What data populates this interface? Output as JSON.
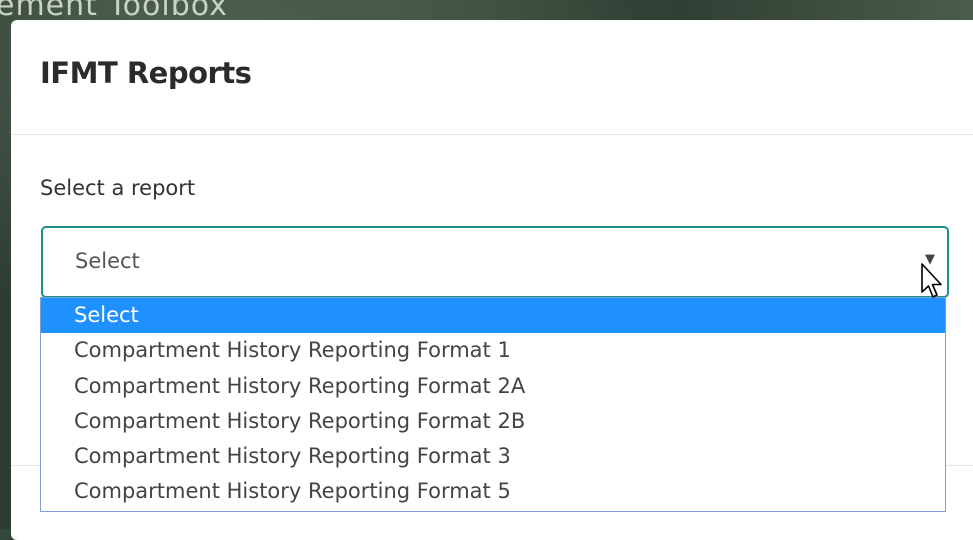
{
  "background": {
    "text": "ement Toolbox"
  },
  "modal": {
    "title": "IFMT Reports",
    "field_label": "Select a report",
    "select": {
      "value": "Select",
      "arrow_icon": "caret-down-icon",
      "options": [
        {
          "label": "Select",
          "selected": true
        },
        {
          "label": "Compartment History Reporting Format 1",
          "selected": false
        },
        {
          "label": "Compartment History Reporting Format 2A",
          "selected": false
        },
        {
          "label": "Compartment History Reporting Format 2B",
          "selected": false
        },
        {
          "label": "Compartment History Reporting Format 3",
          "selected": false
        },
        {
          "label": "Compartment History Reporting Format 5",
          "selected": false
        }
      ]
    }
  },
  "colors": {
    "accent_border": "#1e8f82",
    "option_highlight": "#1e90ff"
  }
}
